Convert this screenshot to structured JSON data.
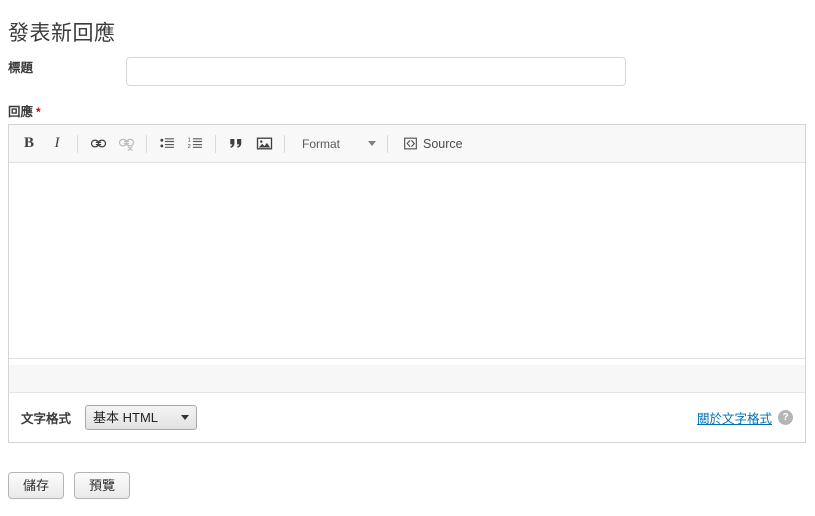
{
  "page": {
    "title": "發表新回應"
  },
  "fields": {
    "subject": {
      "label": "標題",
      "value": "",
      "placeholder": ""
    },
    "body": {
      "label": "回應",
      "required_marker": "*",
      "value": ""
    }
  },
  "editor": {
    "toolbar": {
      "bold": {
        "label": "B",
        "icon": "bold-icon",
        "state": "enabled"
      },
      "italic": {
        "label": "I",
        "icon": "italic-icon",
        "state": "enabled"
      },
      "link": {
        "icon": "link-icon",
        "state": "enabled"
      },
      "unlink": {
        "icon": "unlink-icon",
        "state": "disabled"
      },
      "bulleted_list": {
        "icon": "bulleted-list-icon",
        "state": "enabled"
      },
      "numbered_list": {
        "icon": "numbered-list-icon",
        "state": "enabled"
      },
      "blockquote": {
        "icon": "blockquote-icon",
        "state": "enabled"
      },
      "image": {
        "icon": "image-icon",
        "state": "enabled"
      },
      "format": {
        "label": "Format",
        "icon": "chevron-down-icon"
      },
      "source": {
        "label": "Source",
        "icon": "source-code-icon"
      }
    }
  },
  "text_format": {
    "label": "文字格式",
    "selected": "基本 HTML",
    "options": [
      "基本 HTML"
    ],
    "help_link": "關於文字格式",
    "help_icon_glyph": "?"
  },
  "actions": {
    "save": "儲存",
    "preview": "預覽"
  },
  "colors": {
    "required": "#e00000",
    "link": "#0071b3",
    "toolbar_bg": "#f8f8f8",
    "border": "#d4d4d4"
  }
}
